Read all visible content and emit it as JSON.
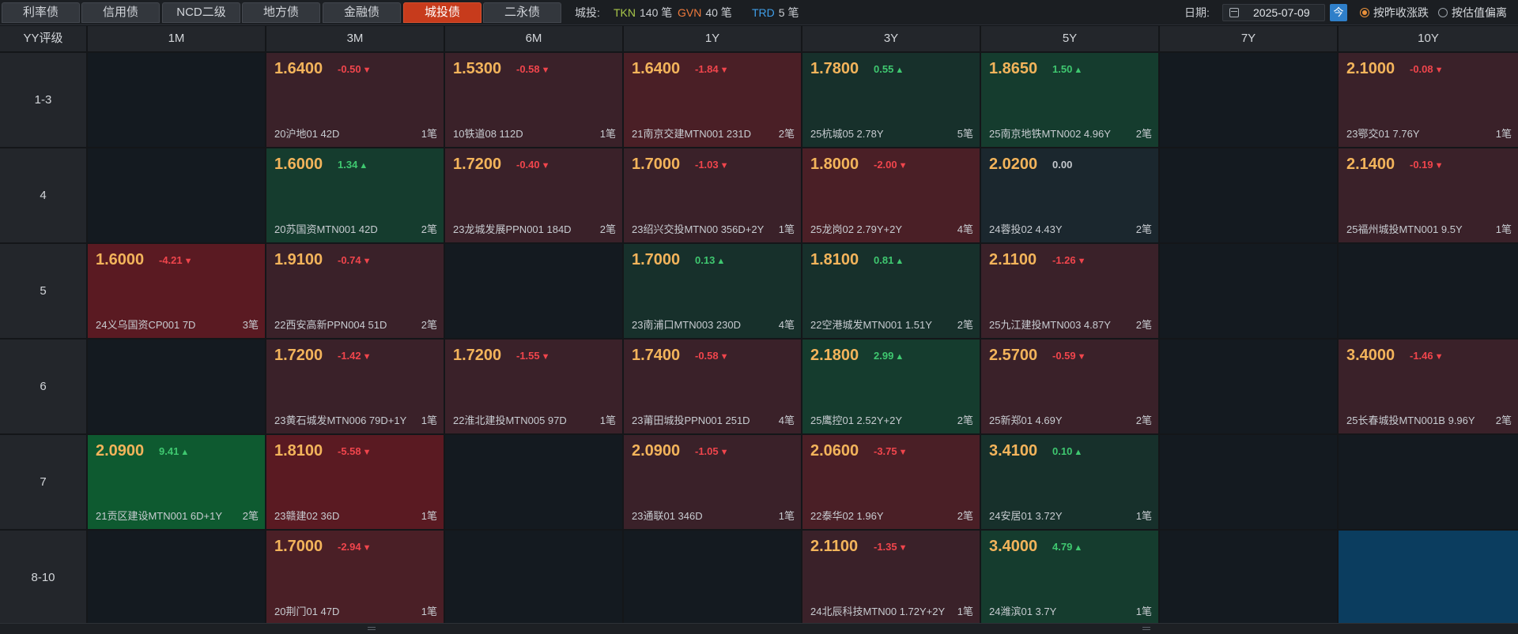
{
  "tabs": [
    {
      "label": "利率债",
      "active": false
    },
    {
      "label": "信用债",
      "active": false
    },
    {
      "label": "NCD二级",
      "active": false
    },
    {
      "label": "地方债",
      "active": false
    },
    {
      "label": "金融债",
      "active": false
    },
    {
      "label": "城投债",
      "active": true
    },
    {
      "label": "二永债",
      "active": false
    }
  ],
  "stats": {
    "label": "城投:",
    "items": [
      {
        "code": "TKN",
        "count": "140 笔",
        "color": "#a8c64a"
      },
      {
        "code": "GVN",
        "count": "40 笔",
        "color": "#ef7a3c"
      },
      {
        "code": "TRD",
        "count": "5 笔",
        "color": "#3f9ee8"
      }
    ]
  },
  "date": {
    "label": "日期:",
    "value": "2025-07-09",
    "today_button": "今"
  },
  "radios": [
    {
      "label": "按昨收涨跌",
      "checked": true
    },
    {
      "label": "按估值偏离",
      "checked": false
    }
  ],
  "grid": {
    "corner": "YY评级",
    "columns": [
      "1M",
      "3M",
      "6M",
      "1Y",
      "3Y",
      "5Y",
      "7Y",
      "10Y"
    ],
    "rows": [
      {
        "rating": "1-3",
        "cells": [
          null,
          {
            "yield": "1.6400",
            "change": "-0.50",
            "dir": "down",
            "tone": "down-light",
            "name": "20沪地01 42D",
            "count": "1笔"
          },
          {
            "yield": "1.5300",
            "change": "-0.58",
            "dir": "down",
            "tone": "down-light",
            "name": "10铁道08 112D",
            "count": "1笔"
          },
          {
            "yield": "1.6400",
            "change": "-1.84",
            "dir": "down",
            "tone": "down-mid",
            "name": "21南京交建MTN001 231D",
            "count": "2笔"
          },
          {
            "yield": "1.7800",
            "change": "0.55",
            "dir": "up",
            "tone": "up-light",
            "name": "25杭城05 2.78Y",
            "count": "5笔"
          },
          {
            "yield": "1.8650",
            "change": "1.50",
            "dir": "up",
            "tone": "up-mid",
            "name": "25南京地铁MTN002 4.96Y",
            "count": "2笔"
          },
          null,
          {
            "yield": "2.1000",
            "change": "-0.08",
            "dir": "down",
            "tone": "down-light",
            "name": "23鄂交01 7.76Y",
            "count": "1笔"
          }
        ]
      },
      {
        "rating": "4",
        "cells": [
          null,
          {
            "yield": "1.6000",
            "change": "1.34",
            "dir": "up",
            "tone": "up-mid",
            "name": "20苏国资MTN001 42D",
            "count": "2笔"
          },
          {
            "yield": "1.7200",
            "change": "-0.40",
            "dir": "down",
            "tone": "down-light",
            "name": "23龙城发展PPN001 184D",
            "count": "2笔"
          },
          {
            "yield": "1.7000",
            "change": "-1.03",
            "dir": "down",
            "tone": "down-light",
            "name": "23绍兴交投MTN00 356D+2Y",
            "count": "1笔"
          },
          {
            "yield": "1.8000",
            "change": "-2.00",
            "dir": "down",
            "tone": "down-mid",
            "name": "25龙岗02 2.79Y+2Y",
            "count": "4笔"
          },
          {
            "yield": "2.0200",
            "change": "0.00",
            "dir": "flat",
            "tone": "neutral",
            "name": "24蓉投02 4.43Y",
            "count": "2笔"
          },
          null,
          {
            "yield": "2.1400",
            "change": "-0.19",
            "dir": "down",
            "tone": "down-light",
            "name": "25福州城投MTN001 9.5Y",
            "count": "1笔"
          }
        ]
      },
      {
        "rating": "5",
        "cells": [
          {
            "yield": "1.6000",
            "change": "-4.21",
            "dir": "down",
            "tone": "down-strong",
            "name": "24义乌国资CP001 7D",
            "count": "3笔"
          },
          {
            "yield": "1.9100",
            "change": "-0.74",
            "dir": "down",
            "tone": "down-light",
            "name": "22西安高新PPN004 51D",
            "count": "2笔"
          },
          null,
          {
            "yield": "1.7000",
            "change": "0.13",
            "dir": "up",
            "tone": "up-light",
            "name": "23南浦口MTN003 230D",
            "count": "4笔"
          },
          {
            "yield": "1.8100",
            "change": "0.81",
            "dir": "up",
            "tone": "up-light",
            "name": "22空港城发MTN001 1.51Y",
            "count": "2笔"
          },
          {
            "yield": "2.1100",
            "change": "-1.26",
            "dir": "down",
            "tone": "down-light",
            "name": "25九江建投MTN003 4.87Y",
            "count": "2笔"
          },
          null,
          null
        ]
      },
      {
        "rating": "6",
        "cells": [
          null,
          {
            "yield": "1.7200",
            "change": "-1.42",
            "dir": "down",
            "tone": "down-light",
            "name": "23黄石城发MTN006 79D+1Y",
            "count": "1笔"
          },
          {
            "yield": "1.7200",
            "change": "-1.55",
            "dir": "down",
            "tone": "down-light",
            "name": "22淮北建投MTN005 97D",
            "count": "1笔"
          },
          {
            "yield": "1.7400",
            "change": "-0.58",
            "dir": "down",
            "tone": "down-light",
            "name": "23莆田城投PPN001 251D",
            "count": "4笔"
          },
          {
            "yield": "2.1800",
            "change": "2.99",
            "dir": "up",
            "tone": "up-mid",
            "name": "25鹰控01 2.52Y+2Y",
            "count": "2笔"
          },
          {
            "yield": "2.5700",
            "change": "-0.59",
            "dir": "down",
            "tone": "down-light",
            "name": "25新郑01 4.69Y",
            "count": "2笔"
          },
          null,
          {
            "yield": "3.4000",
            "change": "-1.46",
            "dir": "down",
            "tone": "down-light",
            "name": "25长春城投MTN001B 9.96Y",
            "count": "2笔"
          }
        ]
      },
      {
        "rating": "7",
        "cells": [
          {
            "yield": "2.0900",
            "change": "9.41",
            "dir": "up",
            "tone": "up-strong",
            "name": "21贡区建设MTN001 6D+1Y",
            "count": "2笔"
          },
          {
            "yield": "1.8100",
            "change": "-5.58",
            "dir": "down",
            "tone": "down-strong",
            "name": "23赣建02 36D",
            "count": "1笔"
          },
          null,
          {
            "yield": "2.0900",
            "change": "-1.05",
            "dir": "down",
            "tone": "down-light",
            "name": "23通联01 346D",
            "count": "1笔"
          },
          {
            "yield": "2.0600",
            "change": "-3.75",
            "dir": "down",
            "tone": "down-mid",
            "name": "22泰华02 1.96Y",
            "count": "2笔"
          },
          {
            "yield": "3.4100",
            "change": "0.10",
            "dir": "up",
            "tone": "up-light",
            "name": "24安居01 3.72Y",
            "count": "1笔"
          },
          null,
          null
        ]
      },
      {
        "rating": "8-10",
        "cells": [
          null,
          {
            "yield": "1.7000",
            "change": "-2.94",
            "dir": "down",
            "tone": "down-mid",
            "name": "20荆门01 47D",
            "count": "1笔"
          },
          null,
          null,
          {
            "yield": "2.1100",
            "change": "-1.35",
            "dir": "down",
            "tone": "down-light",
            "name": "24北辰科技MTN00 1.72Y+2Y",
            "count": "1笔"
          },
          {
            "yield": "3.4000",
            "change": "4.79",
            "dir": "up",
            "tone": "up-mid",
            "name": "24潍滨01 3.7Y",
            "count": "1笔"
          },
          null,
          "selected"
        ]
      }
    ]
  }
}
